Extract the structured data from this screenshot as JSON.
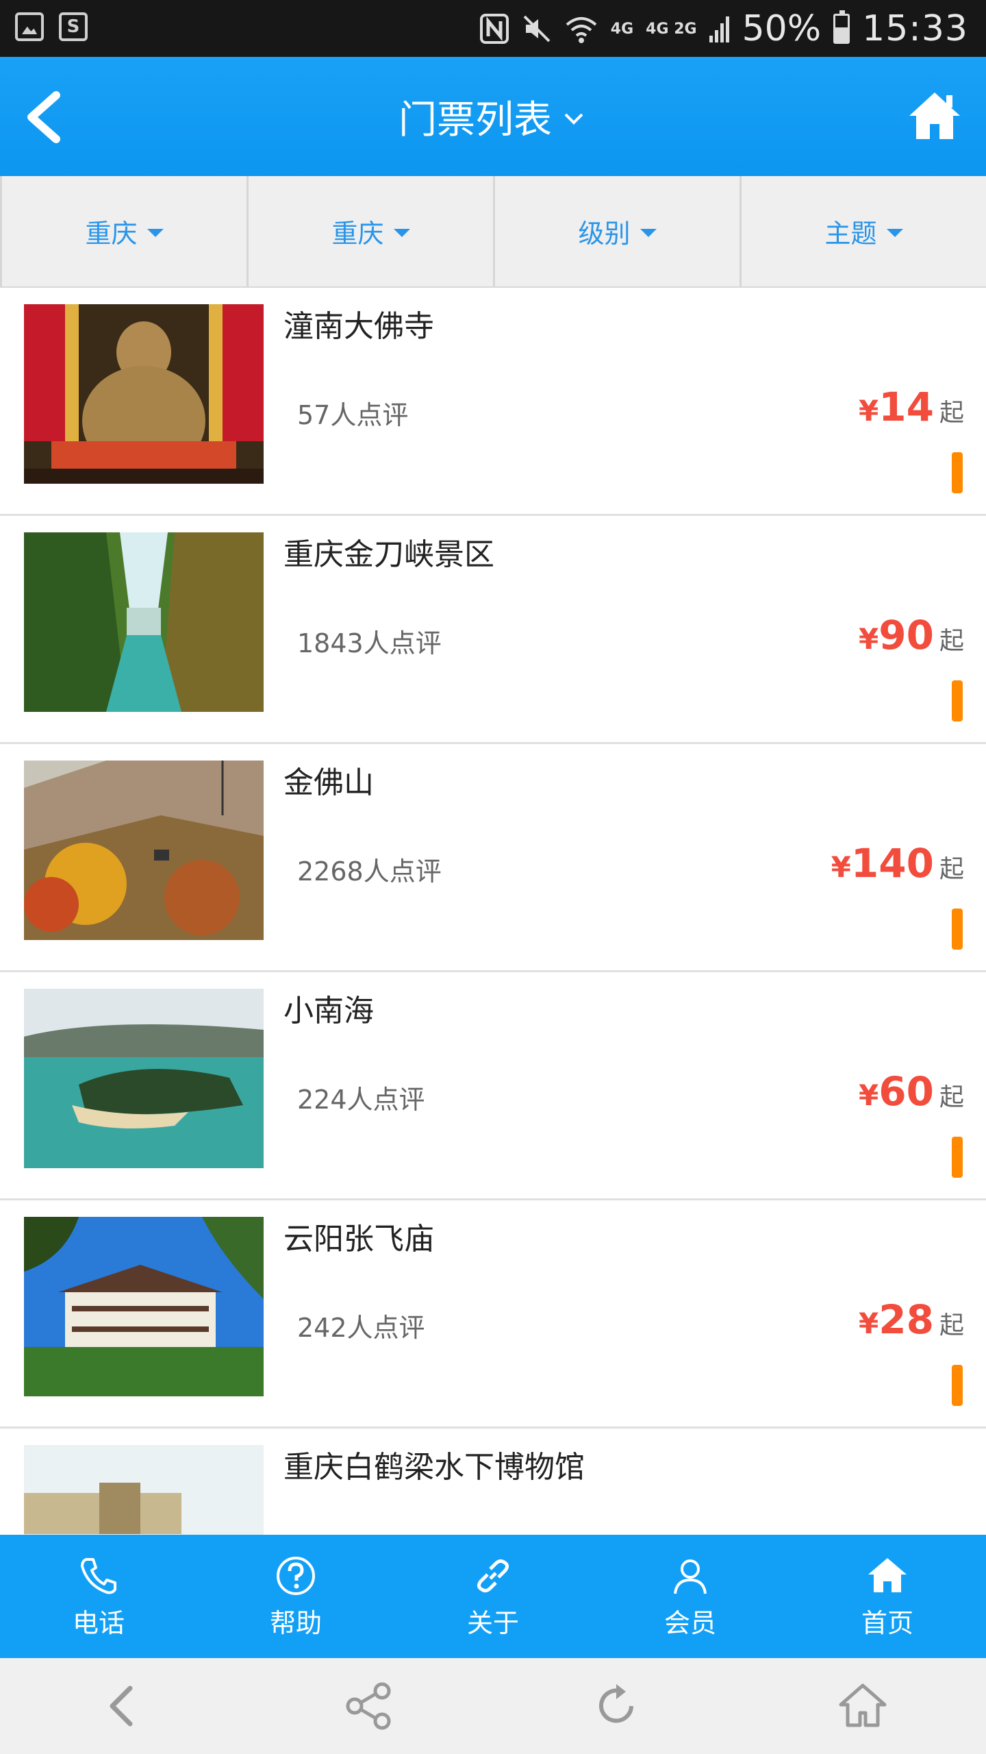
{
  "status_bar": {
    "net_4g": "4G",
    "net_4g2g": "4G 2G",
    "battery": "50%",
    "time": "15:33"
  },
  "header": {
    "title": "门票列表"
  },
  "filters": [
    {
      "label": "重庆"
    },
    {
      "label": "重庆"
    },
    {
      "label": "级别"
    },
    {
      "label": "主题"
    }
  ],
  "items": [
    {
      "name": "潼南大佛寺",
      "reviews": "57人点评",
      "currency": "¥",
      "price": "14",
      "suffix": "起"
    },
    {
      "name": "重庆金刀峡景区",
      "reviews": "1843人点评",
      "currency": "¥",
      "price": "90",
      "suffix": "起"
    },
    {
      "name": "金佛山",
      "reviews": "2268人点评",
      "currency": "¥",
      "price": "140",
      "suffix": "起"
    },
    {
      "name": "小南海",
      "reviews": "224人点评",
      "currency": "¥",
      "price": "60",
      "suffix": "起"
    },
    {
      "name": "云阳张飞庙",
      "reviews": "242人点评",
      "currency": "¥",
      "price": "28",
      "suffix": "起"
    },
    {
      "name": "重庆白鹤梁水下博物馆",
      "reviews": "",
      "currency": "",
      "price": "",
      "suffix": ""
    }
  ],
  "app_nav": [
    {
      "label": "电话",
      "icon": "phone-icon"
    },
    {
      "label": "帮助",
      "icon": "help-icon"
    },
    {
      "label": "关于",
      "icon": "link-icon"
    },
    {
      "label": "会员",
      "icon": "user-icon"
    },
    {
      "label": "首页",
      "icon": "home-icon"
    }
  ],
  "colors": {
    "header_blue": "#0d96f0",
    "filter_text": "#2a95e8",
    "price_red": "#f24c3d",
    "accent_orange": "#ff8a00"
  }
}
